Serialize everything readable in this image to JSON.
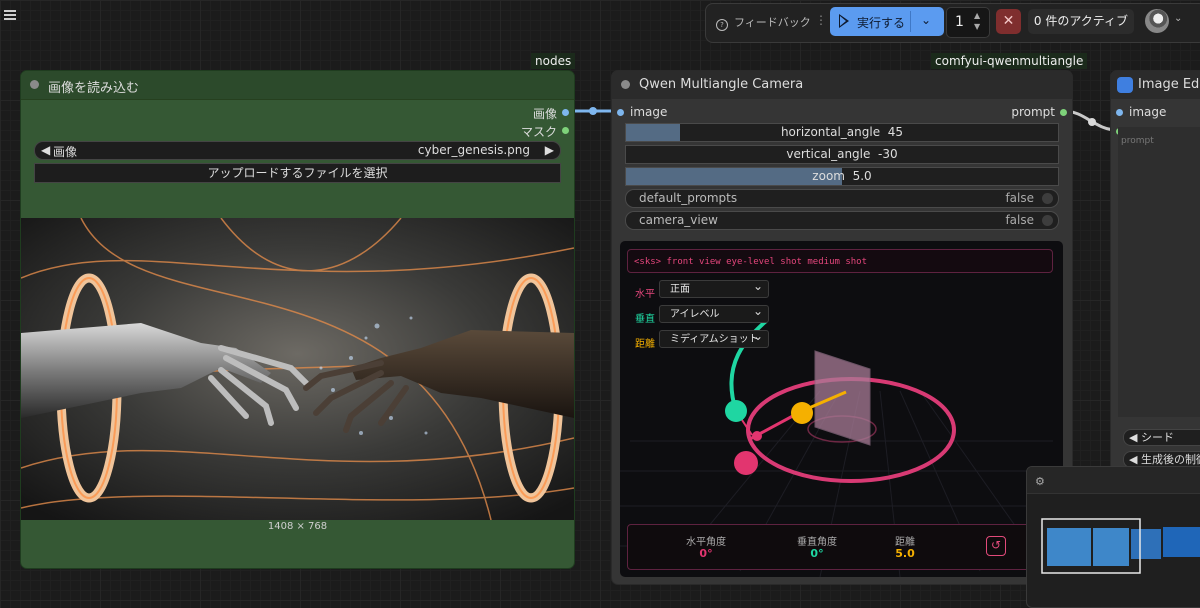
{
  "toolbar": {
    "feedback_label": "フィードバック",
    "run_label": "実行する",
    "queue_count": "1",
    "active_label": "0 件のアクティブ"
  },
  "groups": {
    "left_label": "nodes",
    "right_label": "comfyui-qwenmultiangle"
  },
  "load_image_node": {
    "title": "画像を読み込む",
    "outputs": [
      "画像",
      "マスク"
    ],
    "image_widget": {
      "name": "画像",
      "value": "cyber_genesis.png"
    },
    "upload_label": "アップロードするファイルを選択",
    "dimensions": "1408 × 768"
  },
  "camera_node": {
    "title": "Qwen Multiangle Camera",
    "input_label": "image",
    "output_label": "prompt",
    "horizontal": {
      "label": "horizontal_angle",
      "value": "45",
      "fraction": 0.125
    },
    "vertical": {
      "label": "vertical_angle",
      "value": "-30",
      "fraction": 0.0
    },
    "zoom": {
      "label": "zoom",
      "value": "5.0",
      "fraction": 0.5
    },
    "default_prompts": {
      "label": "default_prompts",
      "value": "false"
    },
    "camera_view": {
      "label": "camera_view",
      "value": "false"
    },
    "prompt_text": "<sks> front view eye-level shot medium shot",
    "selects": {
      "horizontal_label": "水平",
      "horizontal_value": "正面",
      "vertical_label": "垂直",
      "vertical_value": "アイレベル",
      "distance_label": "距離",
      "distance_value": "ミディアムショット"
    },
    "readout": {
      "h_label": "水平角度",
      "h_value": "0°",
      "v_label": "垂直角度",
      "v_value": "0°",
      "d_label": "距離",
      "d_value": "5.0"
    }
  },
  "edit_node": {
    "title": "Image Edit",
    "input_label": "image",
    "prompt_placeholder": "prompt",
    "seed_label": "◀ シード",
    "control_label": "◀ 生成後の制御"
  },
  "colors": {
    "group_green": "#355834",
    "accent_blue": "#5b9bf0",
    "pink": "#e2356f",
    "teal": "#1fd6a2",
    "amber": "#f5b000"
  }
}
